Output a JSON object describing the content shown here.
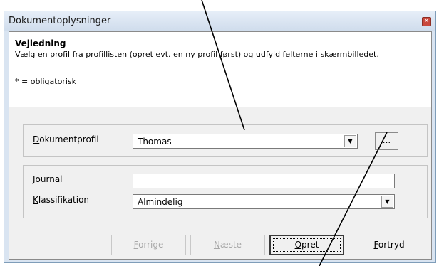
{
  "window": {
    "title": "Dokumentoplysninger"
  },
  "guide": {
    "heading": "Vejledning",
    "text": "Vælg en profil fra profillisten (opret evt. en ny profil først) og udfyld felterne i skærmbilledet.",
    "note": "* = obligatorisk"
  },
  "profile": {
    "label_key": "D",
    "label_rest": "okumentprofil",
    "value": "Thomas",
    "dots_label": "..."
  },
  "journal": {
    "label_key": "J",
    "label_rest": "ournal",
    "value": ""
  },
  "classification": {
    "label_key": "K",
    "label_rest": "lassifikation",
    "value": "Almindelig"
  },
  "buttons": {
    "back": {
      "key": "F",
      "rest": "orrige"
    },
    "next": {
      "key": "N",
      "rest": "æste"
    },
    "create": {
      "key": "O",
      "rest": "pret"
    },
    "cancel": {
      "key": "F",
      "rest": "ortryd"
    }
  },
  "icons": {
    "close": "close-icon",
    "dropdown": "chevron-down-icon"
  }
}
